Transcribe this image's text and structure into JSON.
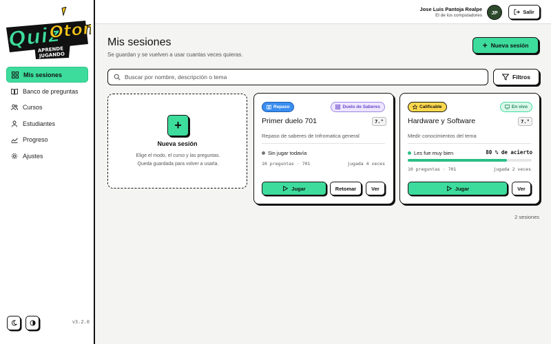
{
  "brand": {
    "logo_main": "QuizOton",
    "logo_sub": "APRENDE JUGANDO",
    "accent": "#3ddc9c",
    "logo_yellow": "#f5c518"
  },
  "sidebar": {
    "items": [
      {
        "label": "Mis sesiones",
        "icon": "grid-icon",
        "active": true
      },
      {
        "label": "Banco de preguntas",
        "icon": "book-icon",
        "active": false
      },
      {
        "label": "Cursos",
        "icon": "users-icon",
        "active": false
      },
      {
        "label": "Estudiantes",
        "icon": "user-icon",
        "active": false
      },
      {
        "label": "Progreso",
        "icon": "trend-icon",
        "active": false
      },
      {
        "label": "Ajustes",
        "icon": "gear-icon",
        "active": false
      }
    ],
    "version": "v3.2.0"
  },
  "topbar": {
    "user_name": "Jose Luis Pantoja Realpe",
    "user_role": "El de los computadores",
    "avatar_initials": "JP",
    "logout_label": "Salir"
  },
  "main": {
    "title": "Mis sesiones",
    "subtitle": "Se guardan y se vuelven a usar cuantas veces quieras.",
    "new_session_label": "Nueva sesión",
    "search_placeholder": "Buscar por nombre, descripción o tema",
    "filters_label": "Filtros",
    "new_card": {
      "title": "Nueva sesión",
      "desc_line1": "Elige el modo, el curso y las preguntas.",
      "desc_line2": "Queda guardada para volver a usarla."
    },
    "count_label": "2 sesiones"
  },
  "sessions": [
    {
      "tag_left": "Repaso",
      "tag_right": "Duelo de Saberes",
      "title": "Primer duelo 701",
      "grade": "7.°",
      "description": "Repaso de saberes de Infromatica general",
      "status": "Sin jugar todavía",
      "status_color": "#777777",
      "meta_left": "10 preguntas · 701",
      "meta_right": "jugada 4 veces",
      "buttons": {
        "play": "Jugar",
        "resume": "Retomar",
        "view": "Ver"
      }
    },
    {
      "tag_left": "Calificable",
      "tag_right": "En vivo",
      "title": "Hardware y Software",
      "grade": "7.°",
      "description": "Medir conocimientos del tema",
      "status": "Les fue muy bien",
      "status_color": "#2bbf86",
      "percent_label": "80 % de acierto",
      "progress": 0.8,
      "meta_left": "10 preguntas · 701",
      "meta_right": "jugada 2 veces",
      "buttons": {
        "play": "Jugar",
        "view": "Ver"
      }
    }
  ]
}
